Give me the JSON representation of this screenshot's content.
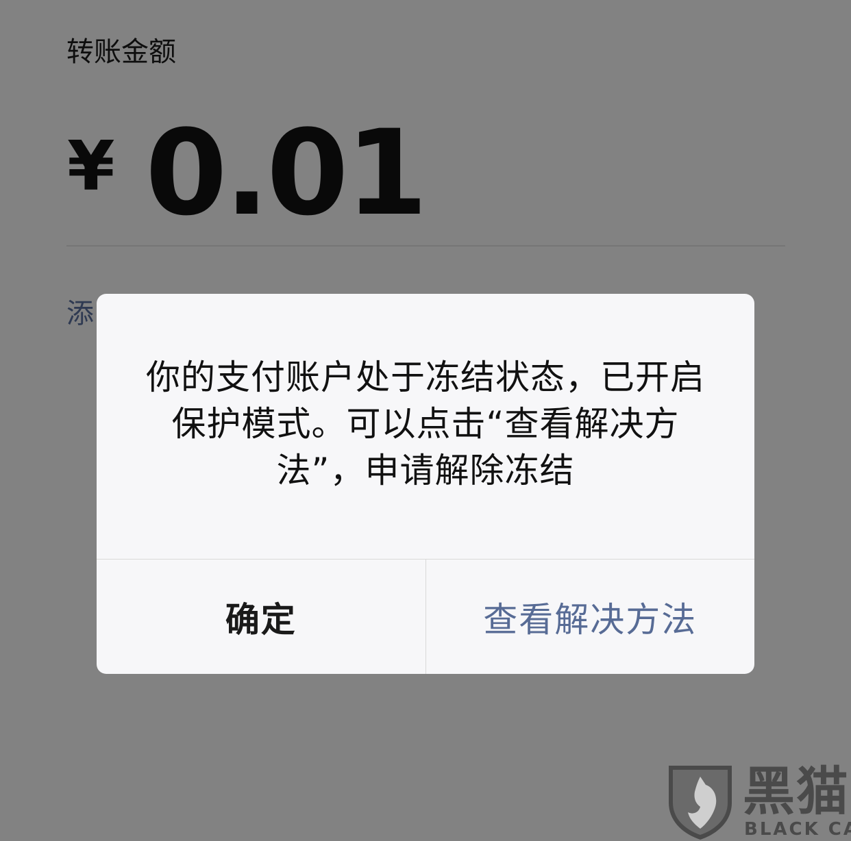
{
  "transfer": {
    "amount_label": "转账金额",
    "currency_symbol": "¥",
    "amount_value": "0.01",
    "add_note_link": "添"
  },
  "dialog": {
    "message": "你的支付账户处于冻结状态，已开启保护模式。可以点击“查看解决方法”，申请解除冻结",
    "confirm_label": "确定",
    "solution_label": "查看解决方法"
  },
  "watermark": {
    "title": "黑猫",
    "subtitle": "BLACK CAT",
    "logo_icon": "cat-shield-icon"
  },
  "colors": {
    "link": "#576b95",
    "mask": "rgba(0,0,0,0.45)",
    "dialog_bg": "#f7f7f9"
  }
}
